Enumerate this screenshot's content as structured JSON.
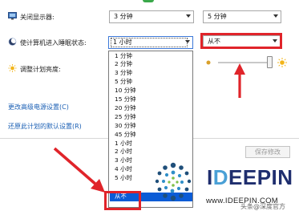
{
  "settings": {
    "display_off_label": "关闭显示器:",
    "sleep_label": "使计算机进入睡眠状态:",
    "brightness_label": "调整计划亮度:",
    "advanced_link": "更改高级电源设置(C)",
    "restore_link": "还原此计划的默认设置(R)"
  },
  "combos": {
    "display_battery": "3 分钟",
    "display_plugged": "5 分钟",
    "sleep_battery": "1 小时",
    "sleep_plugged": "从不"
  },
  "dropdown_options": [
    "1 分钟",
    "2 分钟",
    "3 分钟",
    "5 分钟",
    "10 分钟",
    "15 分钟",
    "20 分钟",
    "25 分钟",
    "30 分钟",
    "45 分钟",
    "1 小时",
    "2 小时",
    "3 小时",
    "4 小时",
    "5 小时",
    "从不"
  ],
  "dropdown_selected": "从不",
  "save_button": "保存修改",
  "logo": {
    "prefix": "I",
    "highlight": "D",
    "suffix": "EEPIN",
    "url": "www.IDEEPIN.COM"
  },
  "watermark": "头条@深度官方",
  "colors": {
    "accent": "#0b5cd6",
    "annotation_red": "#e0242a",
    "link": "#1a5fb4"
  },
  "icons": [
    "monitor-icon",
    "moon-icon",
    "sun-icon",
    "dim-sun-icon",
    "bright-sun-icon",
    "chevron-down-icon",
    "logo-mark-icon",
    "annotation-arrow-icon"
  ]
}
